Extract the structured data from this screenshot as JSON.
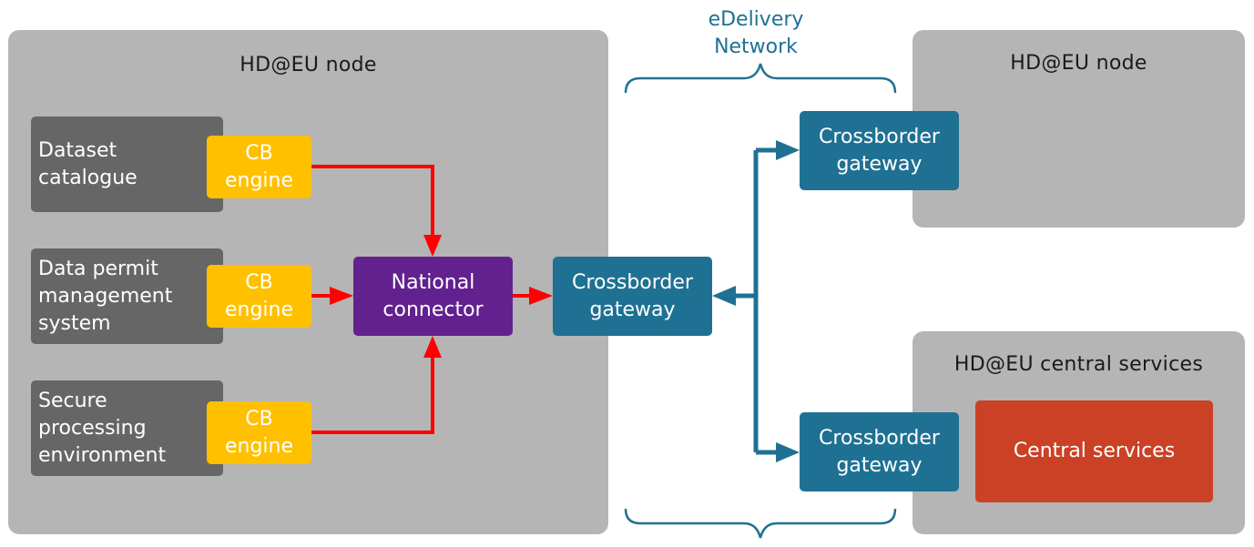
{
  "left_node": {
    "title": "HD@EU node",
    "systems": [
      {
        "label": "Dataset\ncatalogue",
        "engine_label": "CB\nengine"
      },
      {
        "label": "Data permit\nmanagement\nsystem",
        "engine_label": "CB\nengine"
      },
      {
        "label": "Secure\nprocessing\nenvironment",
        "engine_label": "CB\nengine"
      }
    ],
    "national_connector": "National\nconnector",
    "gateway": "Crossborder\ngateway"
  },
  "network": {
    "label": "eDelivery\nNetwork"
  },
  "right_node": {
    "title": "HD@EU node",
    "gateway": "Crossborder\ngateway"
  },
  "central": {
    "title": "HD@EU central services",
    "gateway": "Crossborder\ngateway",
    "services": "Central services"
  },
  "colors": {
    "region": "#b5b5b5",
    "system": "#666666",
    "cb_engine": "#ffc000",
    "national_connector": "#62218f",
    "gateway": "#1f7193",
    "central_services": "#cb4125",
    "internal_flow": "#ff0000",
    "network_flow": "#1f7193"
  }
}
